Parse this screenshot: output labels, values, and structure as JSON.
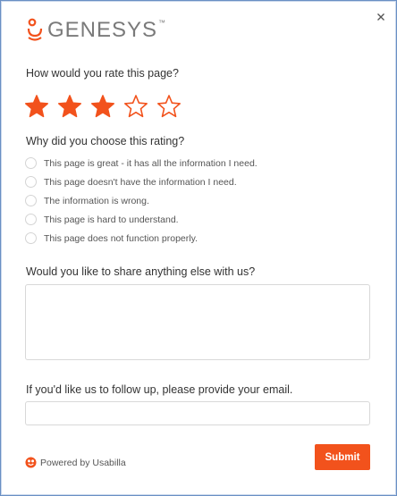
{
  "header": {
    "logo_text": "GENESYS",
    "logo_tm": "™",
    "close_icon": "close-icon"
  },
  "rating": {
    "question": "How would you rate this page?",
    "max": 5,
    "value": 3,
    "color": "#f2521c"
  },
  "reason": {
    "question": "Why did you choose this rating?",
    "options": [
      "This page is great - it has all the information I need.",
      "This page doesn't have the information I need.",
      "The information is wrong.",
      "This page is hard to understand.",
      "This page does not function properly."
    ]
  },
  "comments": {
    "question": "Would you like to share anything else with us?",
    "value": "",
    "placeholder": ""
  },
  "followup": {
    "question": "If you'd like us to follow up, please provide your email.",
    "value": "",
    "placeholder": ""
  },
  "footer": {
    "powered_by": "Powered by Usabilla",
    "submit_label": "Submit"
  },
  "colors": {
    "accent": "#f2521c",
    "border": "#6a8fc4"
  }
}
